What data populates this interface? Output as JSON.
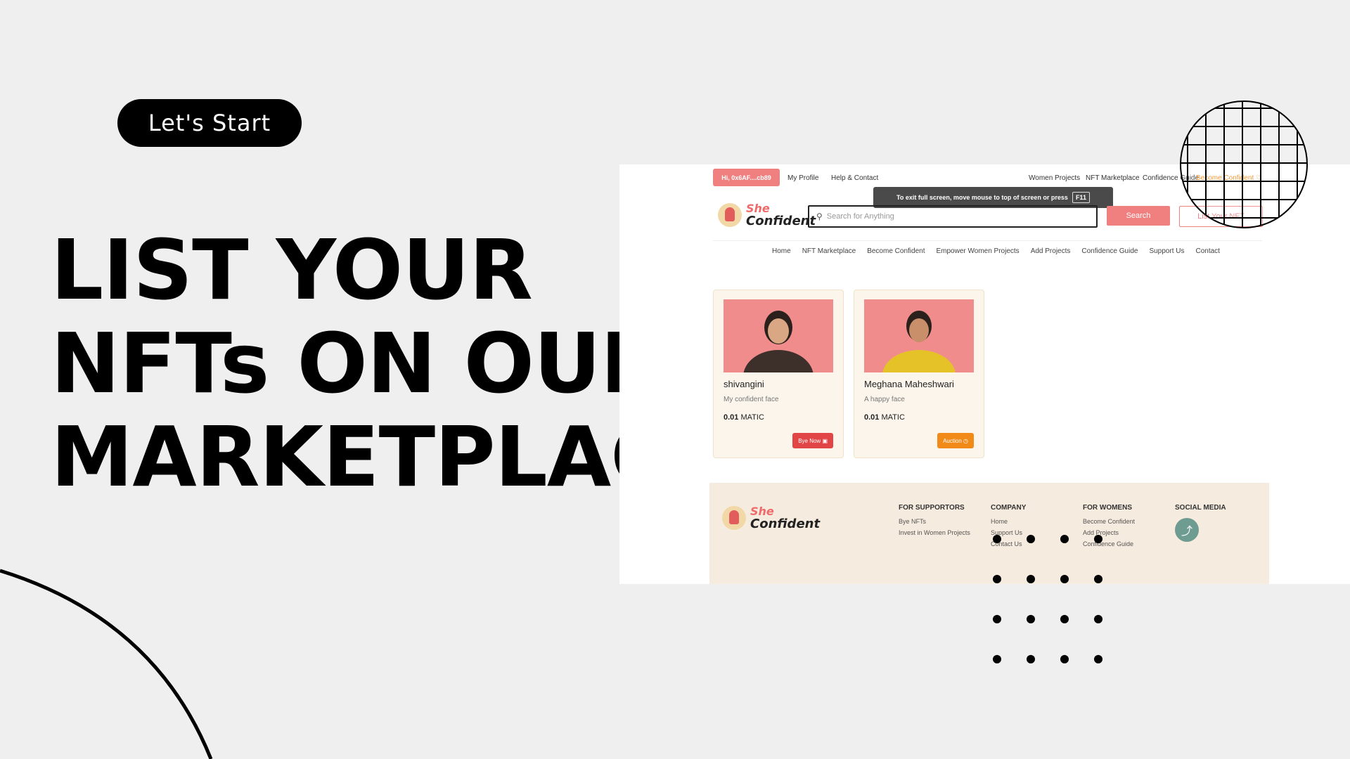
{
  "slide": {
    "pill_label": "Let's Start",
    "headline": [
      "LIST YOUR",
      "NFTs ON OUR",
      "MARKETPLACE"
    ]
  },
  "screenshot": {
    "topbar": {
      "wallet_badge": "Hi, 0x6AF....cb89",
      "links_left": [
        "My Profile",
        "Help & Contact"
      ],
      "links_right": [
        "Women Projects",
        "NFT Marketplace",
        "Confidence Guide",
        "Become Confident"
      ]
    },
    "fullscreen_tip": {
      "text": "To exit full screen, move mouse to top of screen or press",
      "key": "F11"
    },
    "logo": {
      "line1": "She",
      "line2": "Confident"
    },
    "search": {
      "placeholder": "Search for Anything",
      "button": "Search"
    },
    "list_button": "List Your NFT",
    "nav": [
      "Home",
      "NFT Marketplace",
      "Become Confident",
      "Empower Women Projects",
      "Add Projects",
      "Confidence Guide",
      "Support Us",
      "Contact"
    ],
    "cards": [
      {
        "name": "shivangini",
        "desc": "My confident face",
        "price": "0.01",
        "currency": "MATIC",
        "button": "Bye Now",
        "button_color": "#e14545"
      },
      {
        "name": "Meghana Maheshwari",
        "desc": "A happy face",
        "price": "0.01",
        "currency": "MATIC",
        "button": "Auction",
        "button_color": "#f28a1a"
      }
    ],
    "footer": {
      "columns": [
        {
          "heading": "FOR SUPPORTORS",
          "items": [
            "Bye NFTs",
            "Invest in Women Projects"
          ]
        },
        {
          "heading": "COMPANY",
          "items": [
            "Home",
            "Support Us",
            "Contact Us"
          ]
        },
        {
          "heading": "FOR WOMENS",
          "items": [
            "Become Confident",
            "Add Projects",
            "Confidence Guide"
          ]
        },
        {
          "heading": "SOCIAL MEDIA",
          "items": []
        }
      ]
    }
  },
  "icons": [
    "search-icon",
    "share-icon",
    "bag-icon",
    "clock-icon",
    "heart-icon"
  ]
}
